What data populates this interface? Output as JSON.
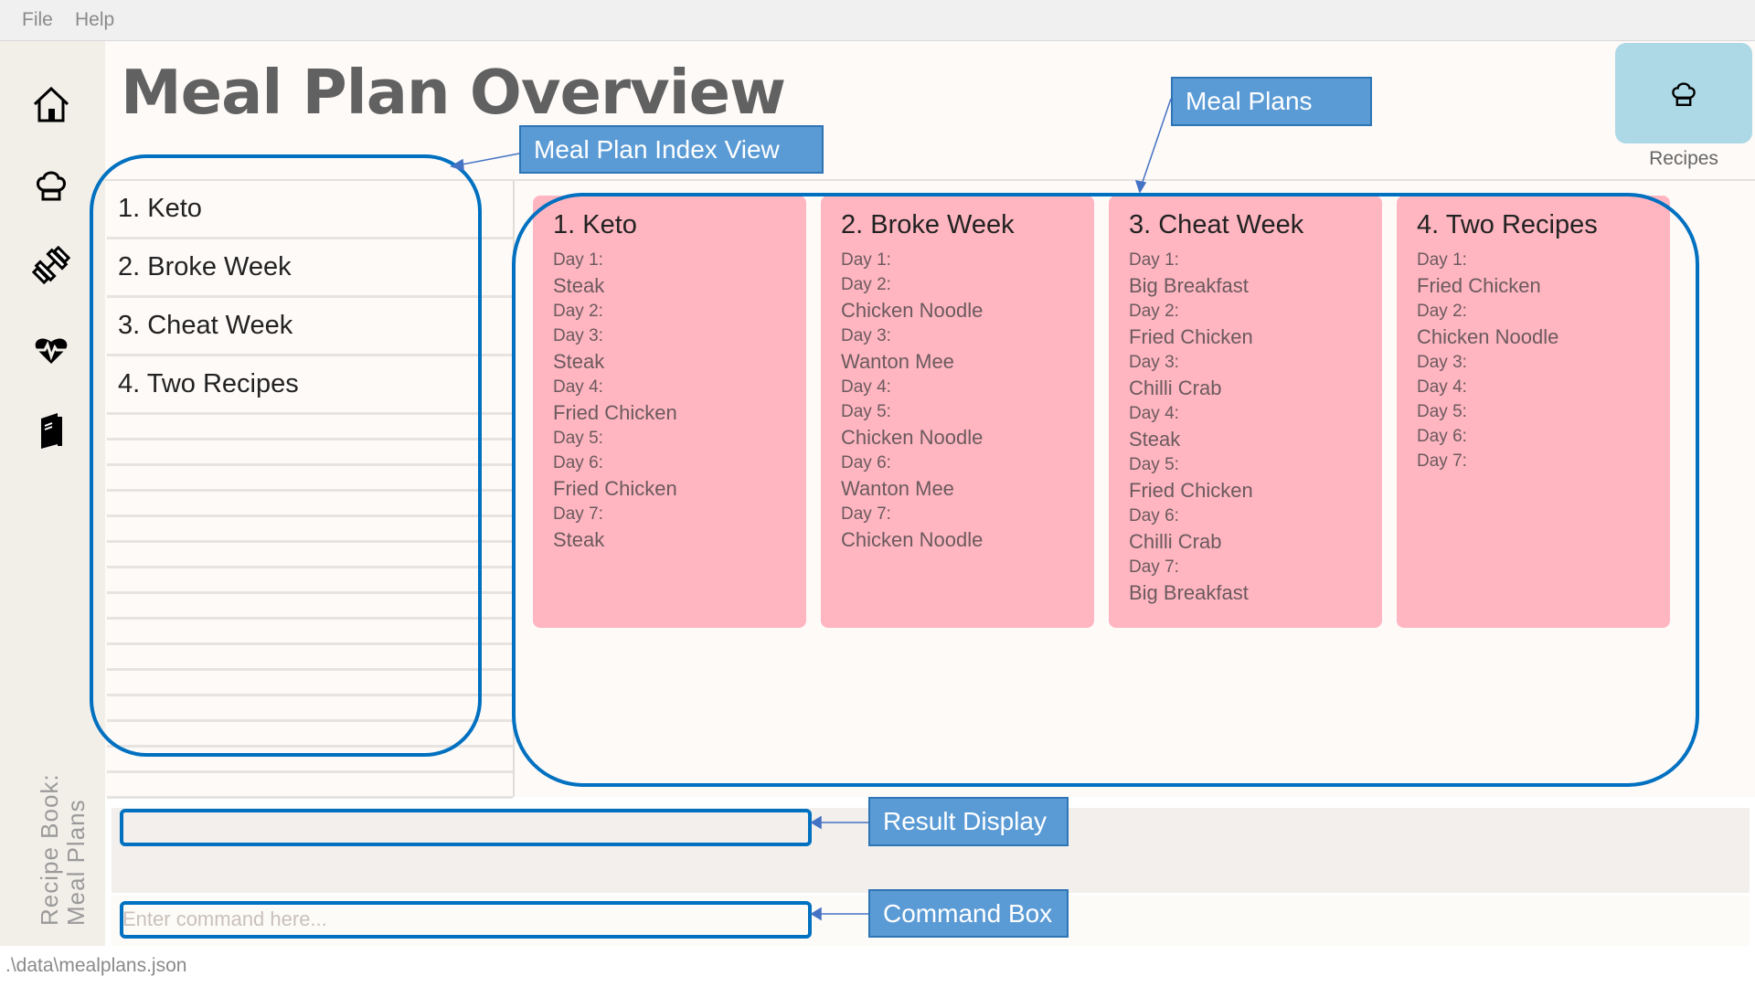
{
  "menu": {
    "file": "File",
    "help": "Help"
  },
  "sidebar": {
    "icons": [
      "home-icon",
      "chef-hat-icon",
      "dumbbell-icon",
      "heartbeat-icon",
      "book-icon"
    ],
    "vertical_text_line1": "Recipe Book:",
    "vertical_text_line2": "Meal Plans"
  },
  "header": {
    "title": "Meal Plan Overview",
    "recipes_button_label": "Recipes"
  },
  "index_list": [
    "1.  Keto",
    "2.  Broke Week",
    "3.  Cheat Week",
    "4.  Two Recipes"
  ],
  "meal_plans": [
    {
      "title": "1.  Keto",
      "lines": [
        [
          "Day 1:",
          "day"
        ],
        [
          "Steak",
          "meal"
        ],
        [
          "Day 2:",
          "day"
        ],
        [
          "Day 3:",
          "day"
        ],
        [
          "Steak",
          "meal"
        ],
        [
          "Day 4:",
          "day"
        ],
        [
          "Fried Chicken",
          "meal"
        ],
        [
          "Day 5:",
          "day"
        ],
        [
          "Day 6:",
          "day"
        ],
        [
          "Fried Chicken",
          "meal"
        ],
        [
          "Day 7:",
          "day"
        ],
        [
          "Steak",
          "meal"
        ]
      ]
    },
    {
      "title": "2.  Broke Week",
      "lines": [
        [
          "Day 1:",
          "day"
        ],
        [
          "Day 2:",
          "day"
        ],
        [
          "Chicken Noodle",
          "meal"
        ],
        [
          "Day 3:",
          "day"
        ],
        [
          "Wanton Mee",
          "meal"
        ],
        [
          "Day 4:",
          "day"
        ],
        [
          "Day 5:",
          "day"
        ],
        [
          "Chicken Noodle",
          "meal"
        ],
        [
          "Day 6:",
          "day"
        ],
        [
          "Wanton Mee",
          "meal"
        ],
        [
          "Day 7:",
          "day"
        ],
        [
          "Chicken Noodle",
          "meal"
        ]
      ]
    },
    {
      "title": "3.  Cheat Week",
      "lines": [
        [
          "Day 1:",
          "day"
        ],
        [
          "Big Breakfast",
          "meal"
        ],
        [
          "Day 2:",
          "day"
        ],
        [
          "Fried Chicken",
          "meal"
        ],
        [
          "Day 3:",
          "day"
        ],
        [
          "Chilli Crab",
          "meal"
        ],
        [
          "Day 4:",
          "day"
        ],
        [
          "Steak",
          "meal"
        ],
        [
          "Day 5:",
          "day"
        ],
        [
          "Fried Chicken",
          "meal"
        ],
        [
          "Day 6:",
          "day"
        ],
        [
          "Chilli Crab",
          "meal"
        ],
        [
          "Day 7:",
          "day"
        ],
        [
          "Big Breakfast",
          "meal"
        ]
      ]
    },
    {
      "title": "4.  Two Recipes",
      "lines": [
        [
          "Day 1:",
          "day"
        ],
        [
          "Fried Chicken",
          "meal"
        ],
        [
          "Day 2:",
          "day"
        ],
        [
          "Chicken Noodle",
          "meal"
        ],
        [
          "Day 3:",
          "day"
        ],
        [
          "Day 4:",
          "day"
        ],
        [
          "Day 5:",
          "day"
        ],
        [
          "Day 6:",
          "day"
        ],
        [
          "Day 7:",
          "day"
        ]
      ]
    }
  ],
  "result_display": {
    "text": ""
  },
  "command_box": {
    "placeholder": "Enter command here..."
  },
  "status_bar": {
    "path": ".\\data\\mealplans.json"
  },
  "annotations": {
    "index_view": "Meal Plan Index View",
    "meal_plans": "Meal Plans",
    "result_display": "Result Display",
    "command_box": "Command Box"
  },
  "colors": {
    "card": "#ffb6c1",
    "recipes_button": "#add8e6",
    "annotation_fill": "#5b9bd5",
    "annotation_outline": "#0070c0"
  }
}
